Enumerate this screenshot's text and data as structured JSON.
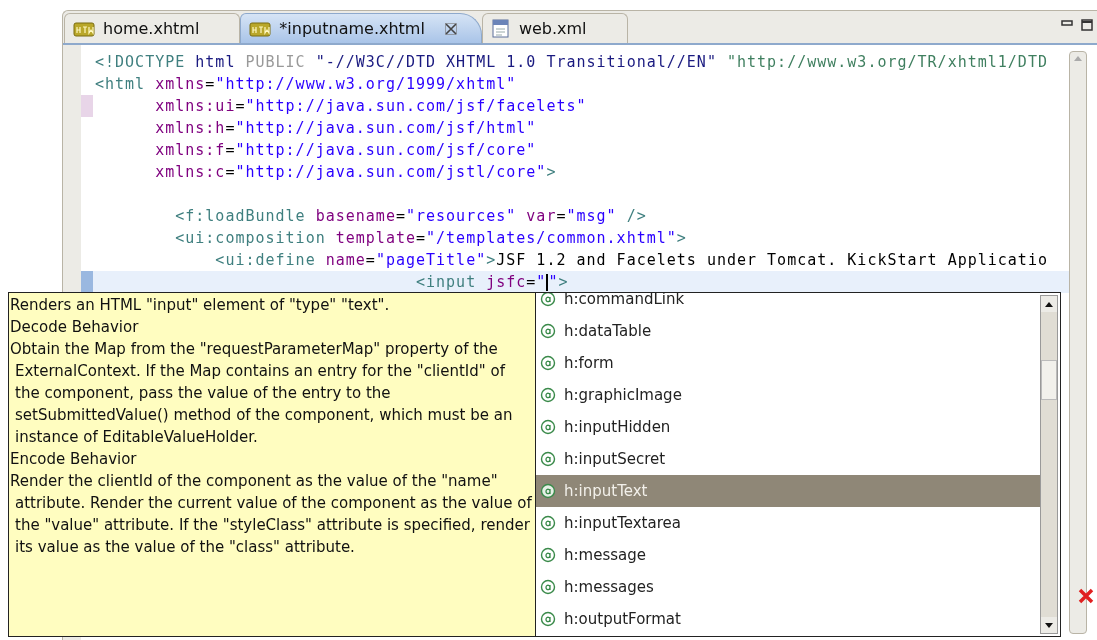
{
  "tabs": [
    {
      "label": "home.xhtml",
      "kind": "xhtml",
      "selected": false
    },
    {
      "label": "*inputname.xhtml",
      "kind": "xhtml",
      "selected": true
    },
    {
      "label": "web.xml",
      "kind": "xml",
      "selected": false
    }
  ],
  "code_lines": [
    {
      "changed": false,
      "current": false,
      "tokens": [
        {
          "kind": "tag",
          "text": "<!DOCTYPE"
        },
        {
          "kind": "doctype",
          "text": " html"
        },
        {
          "kind": "keyword",
          "text": " PUBLIC"
        },
        {
          "kind": "doctype",
          "text": " \"-//W3C//DTD XHTML 1.0 Transitional//EN\""
        },
        {
          "kind": "system",
          "text": " \"http://www.w3.org/TR/xhtml1/DTD"
        }
      ]
    },
    {
      "changed": false,
      "current": false,
      "tokens": [
        {
          "kind": "tag",
          "text": "<html"
        },
        {
          "kind": "attr",
          "text": " xmlns"
        },
        {
          "kind": "plain",
          "text": "="
        },
        {
          "kind": "value",
          "text": "\"http://www.w3.org/1999/xhtml\""
        }
      ]
    },
    {
      "changed": true,
      "current": false,
      "tokens": [
        {
          "kind": "attr",
          "text": "      xmlns:ui"
        },
        {
          "kind": "plain",
          "text": "="
        },
        {
          "kind": "value",
          "text": "\"http://java.sun.com/jsf/facelets\""
        }
      ]
    },
    {
      "changed": false,
      "current": false,
      "tokens": [
        {
          "kind": "attr",
          "text": "      xmlns:h"
        },
        {
          "kind": "plain",
          "text": "="
        },
        {
          "kind": "value",
          "text": "\"http://java.sun.com/jsf/html\""
        }
      ]
    },
    {
      "changed": false,
      "current": false,
      "tokens": [
        {
          "kind": "attr",
          "text": "      xmlns:f"
        },
        {
          "kind": "plain",
          "text": "="
        },
        {
          "kind": "value",
          "text": "\"http://java.sun.com/jsf/core\""
        }
      ]
    },
    {
      "changed": false,
      "current": false,
      "tokens": [
        {
          "kind": "attr",
          "text": "      xmlns:c"
        },
        {
          "kind": "plain",
          "text": "="
        },
        {
          "kind": "value",
          "text": "\"http://java.sun.com/jstl/core\""
        },
        {
          "kind": "tag",
          "text": ">"
        }
      ]
    },
    {
      "changed": false,
      "current": false
    },
    {
      "changed": false,
      "current": false,
      "tokens": [
        {
          "kind": "tag",
          "text": "        <f:loadBundle"
        },
        {
          "kind": "attr",
          "text": " basename"
        },
        {
          "kind": "plain",
          "text": "="
        },
        {
          "kind": "value",
          "text": "\"resources\""
        },
        {
          "kind": "attr",
          "text": " var"
        },
        {
          "kind": "plain",
          "text": "="
        },
        {
          "kind": "value",
          "text": "\"msg\""
        },
        {
          "kind": "tag",
          "text": " />"
        }
      ]
    },
    {
      "changed": false,
      "current": false,
      "tokens": [
        {
          "kind": "tag",
          "text": "        <ui:composition"
        },
        {
          "kind": "attr",
          "text": " template"
        },
        {
          "kind": "plain",
          "text": "="
        },
        {
          "kind": "value",
          "text": "\"/templates/common.xhtml\""
        },
        {
          "kind": "tag",
          "text": ">"
        }
      ]
    },
    {
      "changed": false,
      "current": false,
      "tokens": [
        {
          "kind": "tag",
          "text": "            <ui:define"
        },
        {
          "kind": "attr",
          "text": " name"
        },
        {
          "kind": "plain",
          "text": "="
        },
        {
          "kind": "value",
          "text": "\"pageTitle\""
        },
        {
          "kind": "tag",
          "text": ">"
        },
        {
          "kind": "plain",
          "text": "JSF 1.2 and Facelets under Tomcat. KickStart Applicatio"
        }
      ]
    },
    {
      "changed": false,
      "current": true,
      "tokens": [
        {
          "kind": "tag",
          "text": "                                <input"
        },
        {
          "kind": "attr",
          "text": " jsfc"
        },
        {
          "kind": "plain",
          "text": "="
        },
        {
          "kind": "value",
          "text": "\""
        },
        {
          "kind": "caret"
        },
        {
          "kind": "value",
          "text": "\""
        },
        {
          "kind": "tag",
          "text": ">"
        }
      ]
    }
  ],
  "documentation": [
    {
      "kind": "body",
      "text": "Renders an HTML \"input\" element of \"type\" \"text\"."
    },
    {
      "kind": "heading",
      "text": "Decode Behavior"
    },
    {
      "kind": "body",
      "text": "Obtain the Map from the \"requestParameterMap\" property of the ExternalContext. If the Map contains an entry for the \"clientId\" of the component, pass the value of the entry to the setSubmittedValue() method of the component, which must be an instance of EditableValueHolder."
    },
    {
      "kind": "heading",
      "text": "Encode Behavior"
    },
    {
      "kind": "body",
      "text": "Render the clientId of the component as the value of the \"name\" attribute. Render the current value of the component as the value of the \"value\" attribute. If the \"styleClass\" attribute is specified, render its value as the value of the \"class\" attribute."
    }
  ],
  "proposals": [
    {
      "label": "h:commandLink",
      "selected": false
    },
    {
      "label": "h:dataTable",
      "selected": false
    },
    {
      "label": "h:form",
      "selected": false
    },
    {
      "label": "h:graphicImage",
      "selected": false
    },
    {
      "label": "h:inputHidden",
      "selected": false
    },
    {
      "label": "h:inputSecret",
      "selected": false
    },
    {
      "label": "h:inputText",
      "selected": true
    },
    {
      "label": "h:inputTextarea",
      "selected": false
    },
    {
      "label": "h:message",
      "selected": false
    },
    {
      "label": "h:messages",
      "selected": false
    },
    {
      "label": "h:outputFormat",
      "selected": false
    }
  ]
}
